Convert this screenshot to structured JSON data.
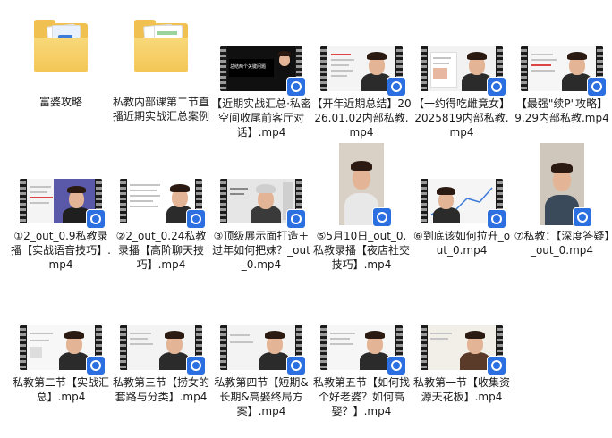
{
  "folders": [
    {
      "label": "富婆攻略",
      "icon": "folder-icon"
    },
    {
      "label": "私教内部课第二节直播近期实战汇总案例",
      "icon": "folder-icon"
    }
  ],
  "videos_row1": [
    {
      "label": "【近期实战汇总·私密空间收尾前客厅对话】.mp4",
      "icon": "video-file-icon",
      "overlay_text": "总结两个关键问题"
    },
    {
      "label": "【开年近期总结】2026.01.02内部私教.mp4",
      "icon": "video-file-icon"
    },
    {
      "label": "【一约得吃雌竟女】2025819内部私教.mp4",
      "icon": "video-file-icon"
    },
    {
      "label": "【最强\"续P\"攻略】9.29内部私教.mp4",
      "icon": "video-file-icon"
    }
  ],
  "videos_row2": [
    {
      "label": "①2_out_0.9私教录播【实战语音技巧】.mp4",
      "icon": "video-file-icon"
    },
    {
      "label": "②2_out_0.24私教录播【高阶聊天技巧】.mp4",
      "icon": "video-file-icon"
    },
    {
      "label": "③顶级展示面打造＋过年如何把妹？_out_0.mp4",
      "icon": "video-file-icon"
    },
    {
      "label": "⑤5月10日_out_0.私教录播【夜店社交技巧】.mp4",
      "icon": "video-file-icon"
    },
    {
      "label": "⑥到底该如何拉升_out_0.mp4",
      "icon": "video-file-icon"
    },
    {
      "label": "⑦私教：【深度答疑】_out_0.mp4",
      "icon": "video-file-icon"
    }
  ],
  "videos_row3": [
    {
      "label": "私教第二节【实战汇总】.mp4",
      "icon": "video-file-icon"
    },
    {
      "label": "私教第三节【捞女的套路与分类】.mp4",
      "icon": "video-file-icon"
    },
    {
      "label": "私教第四节【短期&长期&高娶终局方案】.mp4",
      "icon": "video-file-icon"
    },
    {
      "label": "私教第五节【如何找个好老婆？如何高娶？】.mp4",
      "icon": "video-file-icon"
    },
    {
      "label": "私教第一节【收集资源天花板】.mp4",
      "icon": "video-file-icon"
    }
  ],
  "colors": {
    "folder": "#f0c050",
    "badge": "#2b6fe0",
    "film": "#1b1b1b"
  }
}
